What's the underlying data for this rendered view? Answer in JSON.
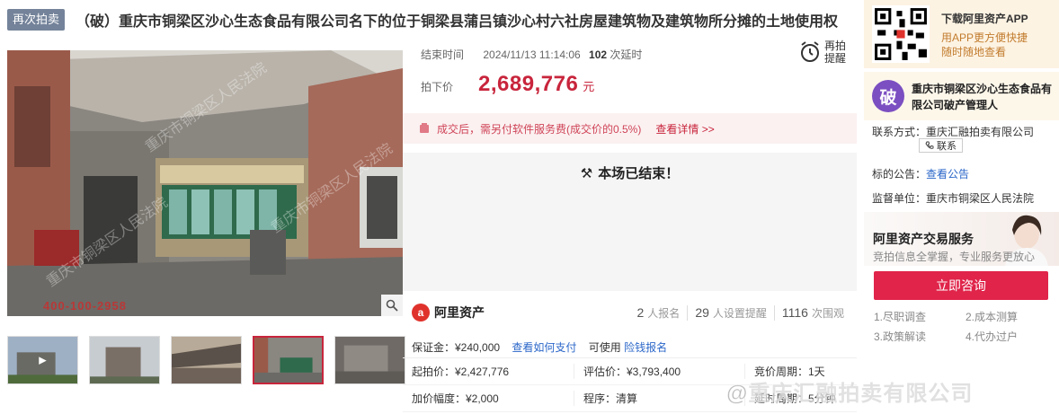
{
  "header": {
    "badge": "再次拍卖",
    "title": "（破）重庆市铜梁区沙心生态食品有限公司名下的位于铜梁县蒲吕镇沙心村六社房屋建筑物及建筑物所分摊的土地使用权"
  },
  "photo": {
    "watermark_text": "重庆市铜梁区人民法院",
    "phone_watermark": "400-100-2958",
    "thumb_count": 5,
    "active_thumb": 3
  },
  "auction": {
    "end_label": "结束时间",
    "end_time": "2024/11/13 11:14:06",
    "delay_count": "102",
    "delay_label": "次延时",
    "remind_label_1": "再拍",
    "remind_label_2": "提醒",
    "price_label": "拍下价",
    "price": "2,689,776",
    "price_unit": "元",
    "fee_notice": "成交后，需另付软件服务费(成交价的0.5%)",
    "fee_link": "查看详情 >>",
    "ended_text": "本场已结束！"
  },
  "stats": {
    "brand": "阿里资产",
    "signups": "2",
    "signups_label": "人报名",
    "reminders": "29",
    "reminders_label": "人设置提醒",
    "views": "1116",
    "views_label": "次围观"
  },
  "deposit": {
    "label": "保证金：¥240,000",
    "how_to_pay": "查看如何支付",
    "available": "可使用",
    "insurance_link": "险钱报名"
  },
  "details": {
    "start_price": "起拍价：¥2,427,776",
    "appraisal": "评估价：¥3,793,400",
    "cycle": "竞价周期：1天",
    "increment": "加价幅度：¥2,000",
    "procedure": "程序：清算",
    "extension": "延时周期：5分钟"
  },
  "sidebar": {
    "app_title": "下载阿里资产APP",
    "app_sub_1": "用APP更方便快捷",
    "app_sub_2": "随时随地查看",
    "org_avatar": "破",
    "org_name": "重庆市铜梁区沙心生态食品有限公司破产管理人",
    "contact_label": "联系方式：重庆汇融拍卖有限公司",
    "contact_button": "联系",
    "notice_label": "标的公告：",
    "notice_link": "查看公告",
    "court_label": "监督单位：重庆市铜梁区人民法院",
    "service_title": "阿里资产交易服务",
    "service_sub": "竞拍信息全掌握，专业服务更放心",
    "consult_button": "立即咨询",
    "services": [
      "1.尽职调查",
      "2.成本测算",
      "3.政策解读",
      "4.代办过户"
    ]
  },
  "overlay": {
    "weibo_watermark": "@重庆汇融拍卖有限公司"
  },
  "colors": {
    "accent_red": "#c8253c",
    "link_blue": "#2b67c9",
    "consult_red": "#e0244a",
    "badge_gray": "#74839a"
  }
}
